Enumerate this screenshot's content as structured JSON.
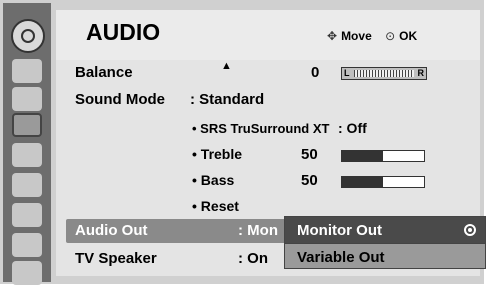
{
  "header": {
    "title": "AUDIO",
    "move_icon": "four-way-arrow-icon",
    "move_label": "Move",
    "ok_icon": "circle-ok-icon",
    "ok_label": "OK"
  },
  "sidebar": {
    "items": [
      {
        "icon": "satellite-dish-icon"
      },
      {
        "icon": "picture-monitor-icon"
      },
      {
        "icon": "speaker-icon",
        "selected": true
      },
      {
        "icon": "clock-icon"
      },
      {
        "icon": "lock-icon"
      },
      {
        "icon": "input-plug-icon"
      },
      {
        "icon": "usb-tree-icon"
      },
      {
        "icon": "clapperboard-icon"
      }
    ]
  },
  "menu": {
    "balance": {
      "label": "Balance",
      "value": "0",
      "left": "L",
      "right": "R",
      "level": 0
    },
    "sound_mode": {
      "label": "Sound Mode",
      "value": ": Standard"
    },
    "srs": {
      "label": "• SRS TruSurround XT",
      "value": ": Off"
    },
    "treble": {
      "label": "• Treble",
      "value": "50",
      "level_pct": 50
    },
    "bass": {
      "label": "• Bass",
      "value": "50",
      "level_pct": 50
    },
    "reset": {
      "label": "• Reset"
    },
    "audio_out": {
      "label": "Audio Out",
      "value": ": Mon"
    },
    "tv_speaker": {
      "label": "TV Speaker",
      "value": ": On"
    }
  },
  "popup": {
    "options": [
      {
        "label": "Monitor Out",
        "selected": true
      },
      {
        "label": "Variable Out",
        "selected": false
      }
    ]
  },
  "colors": {
    "background": "#e4e4e4",
    "sidebar": "#6d6d6d",
    "highlight": "#8a8a8a",
    "popup_selected": "#4a4a4a",
    "text": "#000000"
  }
}
